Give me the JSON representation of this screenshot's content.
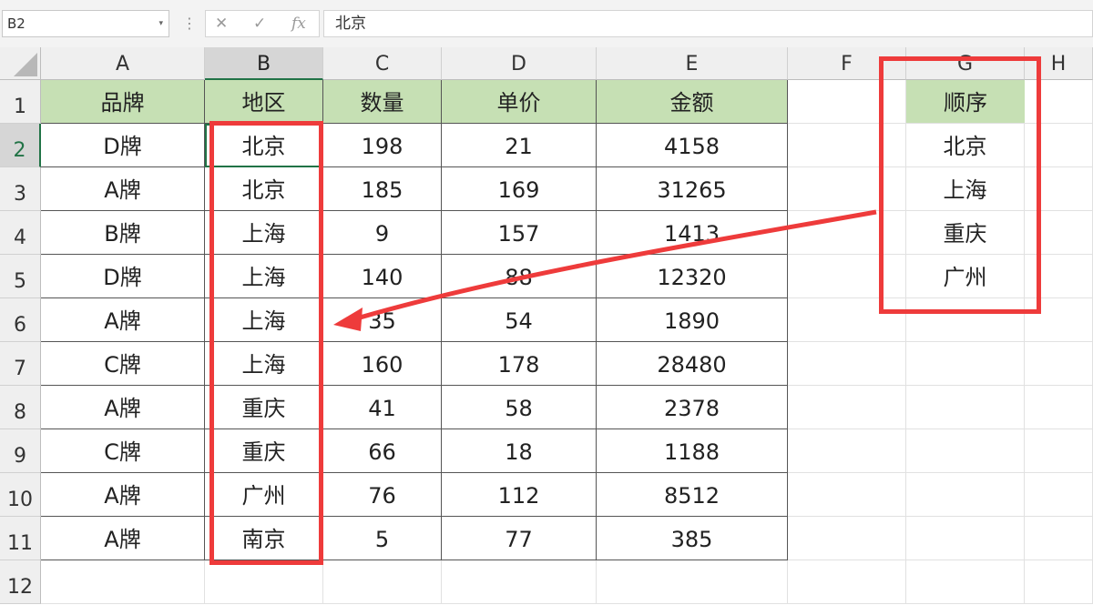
{
  "formula_bar": {
    "name_box": "B2",
    "dropdown_icon": "▾",
    "separator_icon": "⋮",
    "cancel_icon": "✕",
    "enter_icon": "✓",
    "fx_icon": "fx",
    "formula": "北京"
  },
  "columns": [
    "A",
    "B",
    "C",
    "D",
    "E",
    "F",
    "G",
    "H"
  ],
  "rows": [
    "1",
    "2",
    "3",
    "4",
    "5",
    "6",
    "7",
    "8",
    "9",
    "10",
    "11",
    "12"
  ],
  "selected_cell": "B2",
  "table": {
    "headers": [
      "品牌",
      "地区",
      "数量",
      "单价",
      "金额"
    ],
    "rows": [
      [
        "D牌",
        "北京",
        "198",
        "21",
        "4158"
      ],
      [
        "A牌",
        "北京",
        "185",
        "169",
        "31265"
      ],
      [
        "B牌",
        "上海",
        "9",
        "157",
        "1413"
      ],
      [
        "D牌",
        "上海",
        "140",
        "88",
        "12320"
      ],
      [
        "A牌",
        "上海",
        "35",
        "54",
        "1890"
      ],
      [
        "C牌",
        "上海",
        "160",
        "178",
        "28480"
      ],
      [
        "A牌",
        "重庆",
        "41",
        "58",
        "2378"
      ],
      [
        "C牌",
        "重庆",
        "66",
        "18",
        "1188"
      ],
      [
        "A牌",
        "广州",
        "76",
        "112",
        "8512"
      ],
      [
        "A牌",
        "南京",
        "5",
        "77",
        "385"
      ]
    ]
  },
  "order_list": {
    "header": "顺序",
    "items": [
      "北京",
      "上海",
      "重庆",
      "广州"
    ]
  },
  "colors": {
    "header_fill": "#c6e0b4",
    "annotation_red": "#ee3b3b",
    "selection_green": "#217346"
  }
}
